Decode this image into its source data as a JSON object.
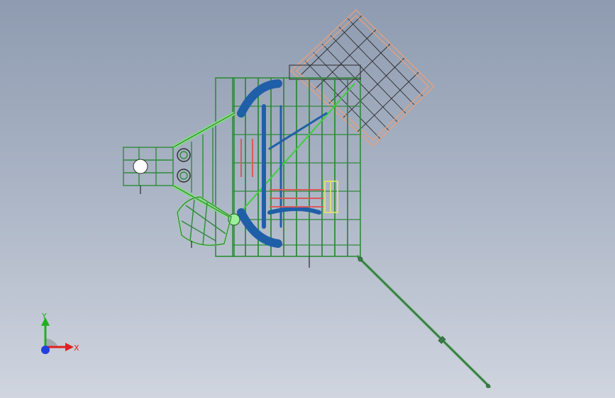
{
  "viewport": {
    "background_top": "#8e9bb0",
    "background_bottom": "#d0d5df"
  },
  "model": {
    "frame_color": "#2e8b3a",
    "frame_light": "#7de07a",
    "pipe_color": "#1f5fa8",
    "roof_color": "#e8a07a",
    "pipe_red": "#d85a5a"
  },
  "triad": {
    "x_label": "X",
    "y_label": "Y",
    "x_color": "#e02020",
    "y_color": "#20b020",
    "z_color": "#2040e0"
  }
}
